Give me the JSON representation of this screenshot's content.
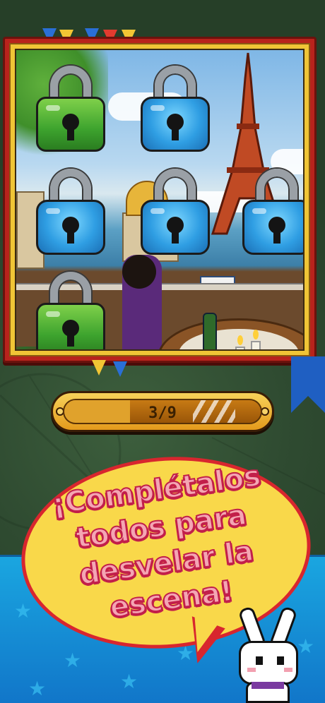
{
  "progress": {
    "count_text": "3/9",
    "unlocked": 3,
    "total": 9
  },
  "locks": [
    {
      "state": "unlocked",
      "color": "green"
    },
    {
      "state": "locked",
      "color": "blue"
    },
    {
      "state": "locked",
      "color": "blue"
    },
    {
      "state": "locked",
      "color": "blue"
    },
    {
      "state": "locked",
      "color": "blue"
    },
    {
      "state": "unlocked",
      "color": "green"
    }
  ],
  "bubble": {
    "lines": [
      "¡Complétalos",
      "todos para",
      "desvelar la",
      "escena!"
    ]
  },
  "colors": {
    "frame_red": "#b8231c",
    "progress_gold": "#f7d25a",
    "bubble_yellow": "#f9d84a",
    "bubble_border": "#d8262e",
    "text_pink": "#f4a6b3",
    "lock_blue": "#2f9ee3",
    "lock_green": "#3da32e",
    "bottom_blue": "#1aa6e0"
  },
  "icons": [
    "padlock-icon",
    "star-icon",
    "bunny-mascot",
    "pennant-flag",
    "ribbon"
  ]
}
